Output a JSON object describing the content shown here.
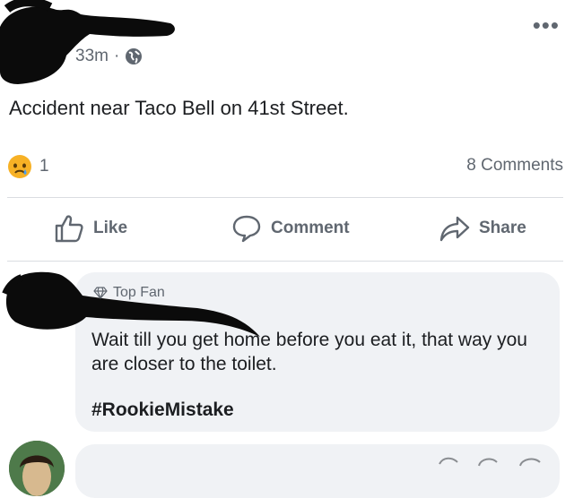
{
  "post": {
    "time": "33m",
    "separator": "·",
    "privacy_icon": "globe-icon",
    "more_label": "•••",
    "text": "Accident near Taco Bell on 41st Street."
  },
  "reactions": {
    "icon": "sad-face-icon",
    "count": "1",
    "comments": "8 Comments"
  },
  "actions": {
    "like": "Like",
    "comment": "Comment",
    "share": "Share"
  },
  "comment": {
    "badge": "Top Fan",
    "badge_icon": "diamond-icon",
    "text": "Wait till you get home before you eat it, that way you are closer to the toilet.",
    "hashtag": "#RookieMistake"
  },
  "colors": {
    "secondary_text": "#606770",
    "bubble_bg": "#f0f2f5",
    "divider": "#dadde1",
    "sad_face": "#f7b125"
  }
}
